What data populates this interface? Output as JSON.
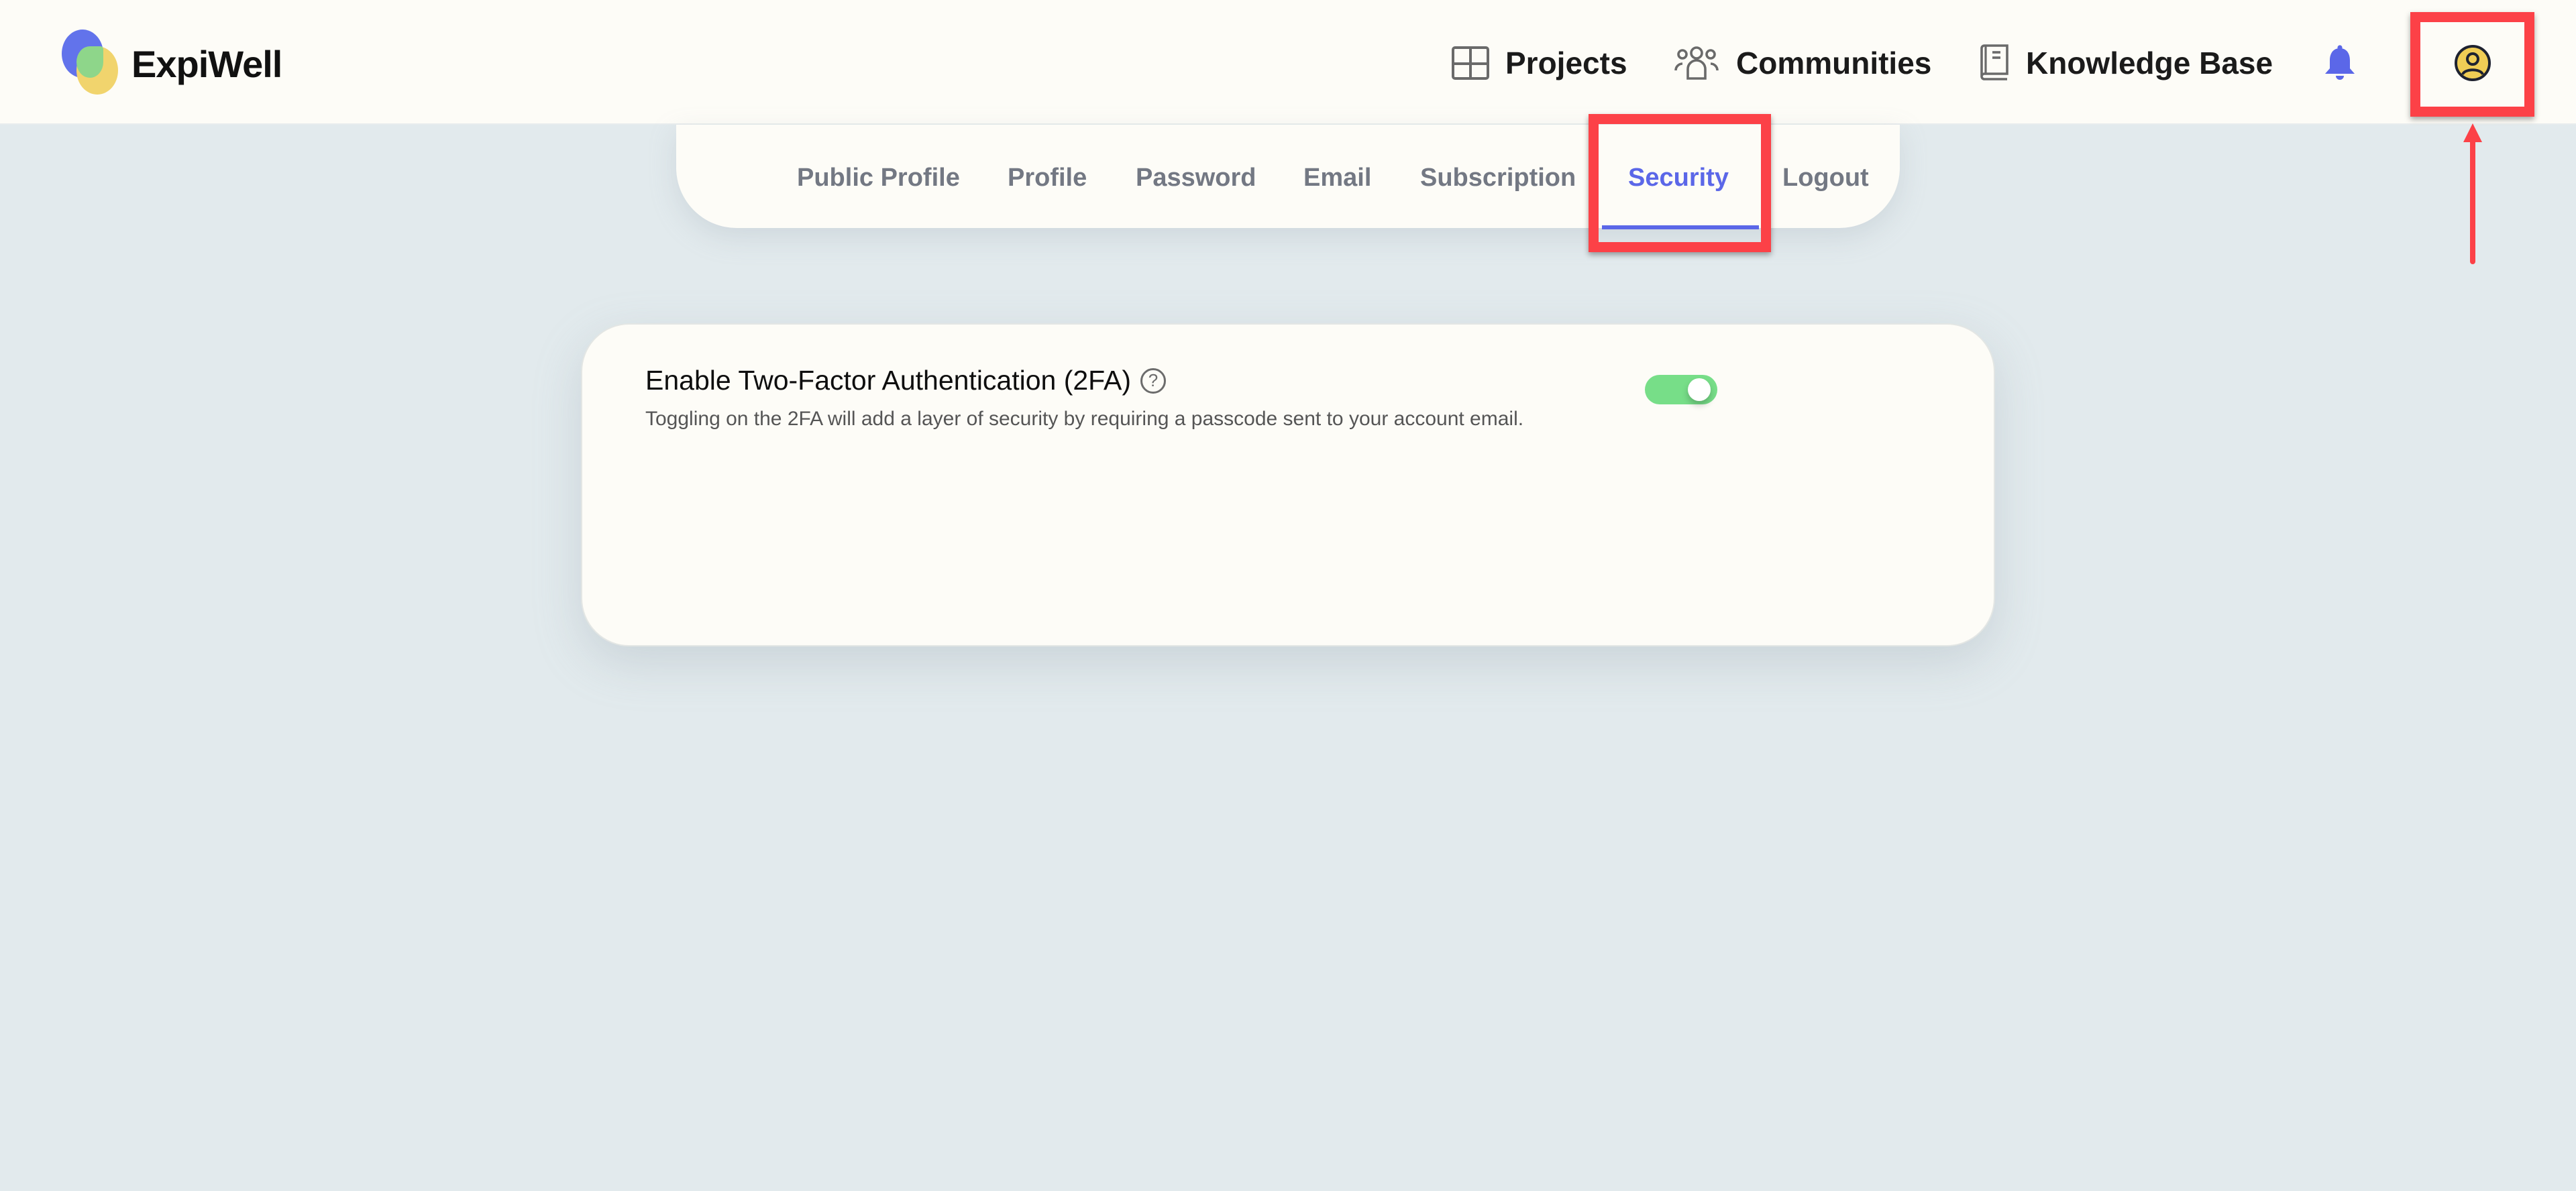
{
  "app": {
    "brand": "ExpiWell"
  },
  "header": {
    "nav": [
      {
        "label": "Projects",
        "icon": "grid-icon"
      },
      {
        "label": "Communities",
        "icon": "users-icon"
      },
      {
        "label": "Knowledge Base",
        "icon": "book-icon"
      }
    ],
    "notifications_icon": "bell-icon",
    "account_icon": "user-circle-icon"
  },
  "settings_tabs": {
    "items": [
      {
        "label": "Public Profile",
        "active": false
      },
      {
        "label": "Profile",
        "active": false
      },
      {
        "label": "Password",
        "active": false
      },
      {
        "label": "Email",
        "active": false
      },
      {
        "label": "Subscription",
        "active": false
      },
      {
        "label": "Security",
        "active": true
      },
      {
        "label": "Logout",
        "active": false
      }
    ]
  },
  "security": {
    "two_factor": {
      "title": "Enable Two-Factor Authentication (2FA)",
      "help_glyph": "?",
      "description": "Toggling on the 2FA will add a layer of security by requiring a passcode sent to your account email.",
      "enabled": true
    }
  },
  "colors": {
    "accent": "#5b67e8",
    "toggle_on": "#77de88",
    "annotation": "#fc4147",
    "brand_blue": "#6273eb",
    "brand_yellow": "#f1d46d",
    "brand_green": "#8ed68a"
  },
  "annotations": [
    {
      "type": "highlight-box",
      "target": "Security tab"
    },
    {
      "type": "highlight-box",
      "target": "account avatar"
    },
    {
      "type": "arrow",
      "direction": "up",
      "target": "account avatar"
    }
  ]
}
